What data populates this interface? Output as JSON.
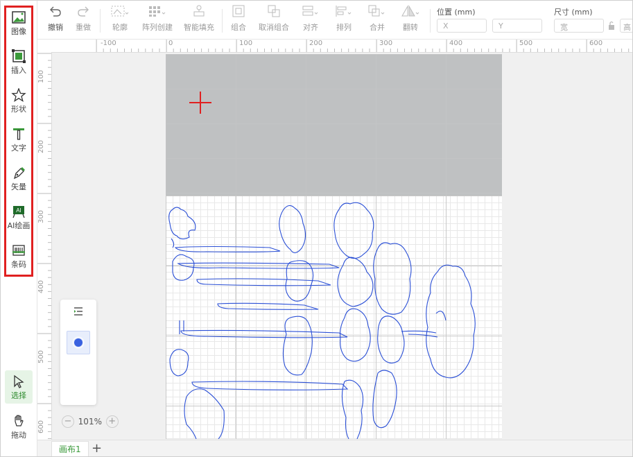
{
  "left_tools": [
    {
      "label": "图像",
      "icon": "image-icon"
    },
    {
      "label": "插入",
      "icon": "insert-icon"
    },
    {
      "label": "形状",
      "icon": "star-shape-icon"
    },
    {
      "label": "文字",
      "icon": "text-icon"
    },
    {
      "label": "矢量",
      "icon": "pen-vector-icon"
    },
    {
      "label": "AI绘画",
      "icon": "ai-painting-icon"
    },
    {
      "label": "条码",
      "icon": "barcode-icon"
    }
  ],
  "mode_tools": [
    {
      "label": "选择",
      "icon": "cursor-select-icon",
      "active": true
    },
    {
      "label": "拖动",
      "icon": "hand-drag-icon",
      "active": false
    }
  ],
  "toolbar": {
    "undo": "撤销",
    "redo": "重做",
    "outline": "轮廓",
    "array": "阵列创建",
    "smart_fill": "智能填充",
    "group": "组合",
    "ungroup": "取消组合",
    "align": "对齐",
    "arrange": "排列",
    "merge": "合并",
    "flip": "翻转"
  },
  "position": {
    "label": "位置 (mm)",
    "x_placeholder": "X",
    "y_placeholder": "Y"
  },
  "size": {
    "label": "尺寸 (mm)",
    "w_placeholder": "宽",
    "h_placeholder": "高"
  },
  "h_ruler": [
    "-100",
    "0",
    "100",
    "200",
    "300",
    "400",
    "500",
    "600"
  ],
  "v_ruler": [
    "100",
    "200",
    "300",
    "400",
    "500",
    "600"
  ],
  "zoom": {
    "value": "101%",
    "minus": "−",
    "plus": "+"
  },
  "canvas_tabs": [
    "画布1"
  ],
  "add_tab": "+",
  "colors": {
    "accent": "#3b9a3b",
    "vector_stroke": "#2a4fd6",
    "highlight": "#e02020",
    "crosshair": "#e02020"
  }
}
